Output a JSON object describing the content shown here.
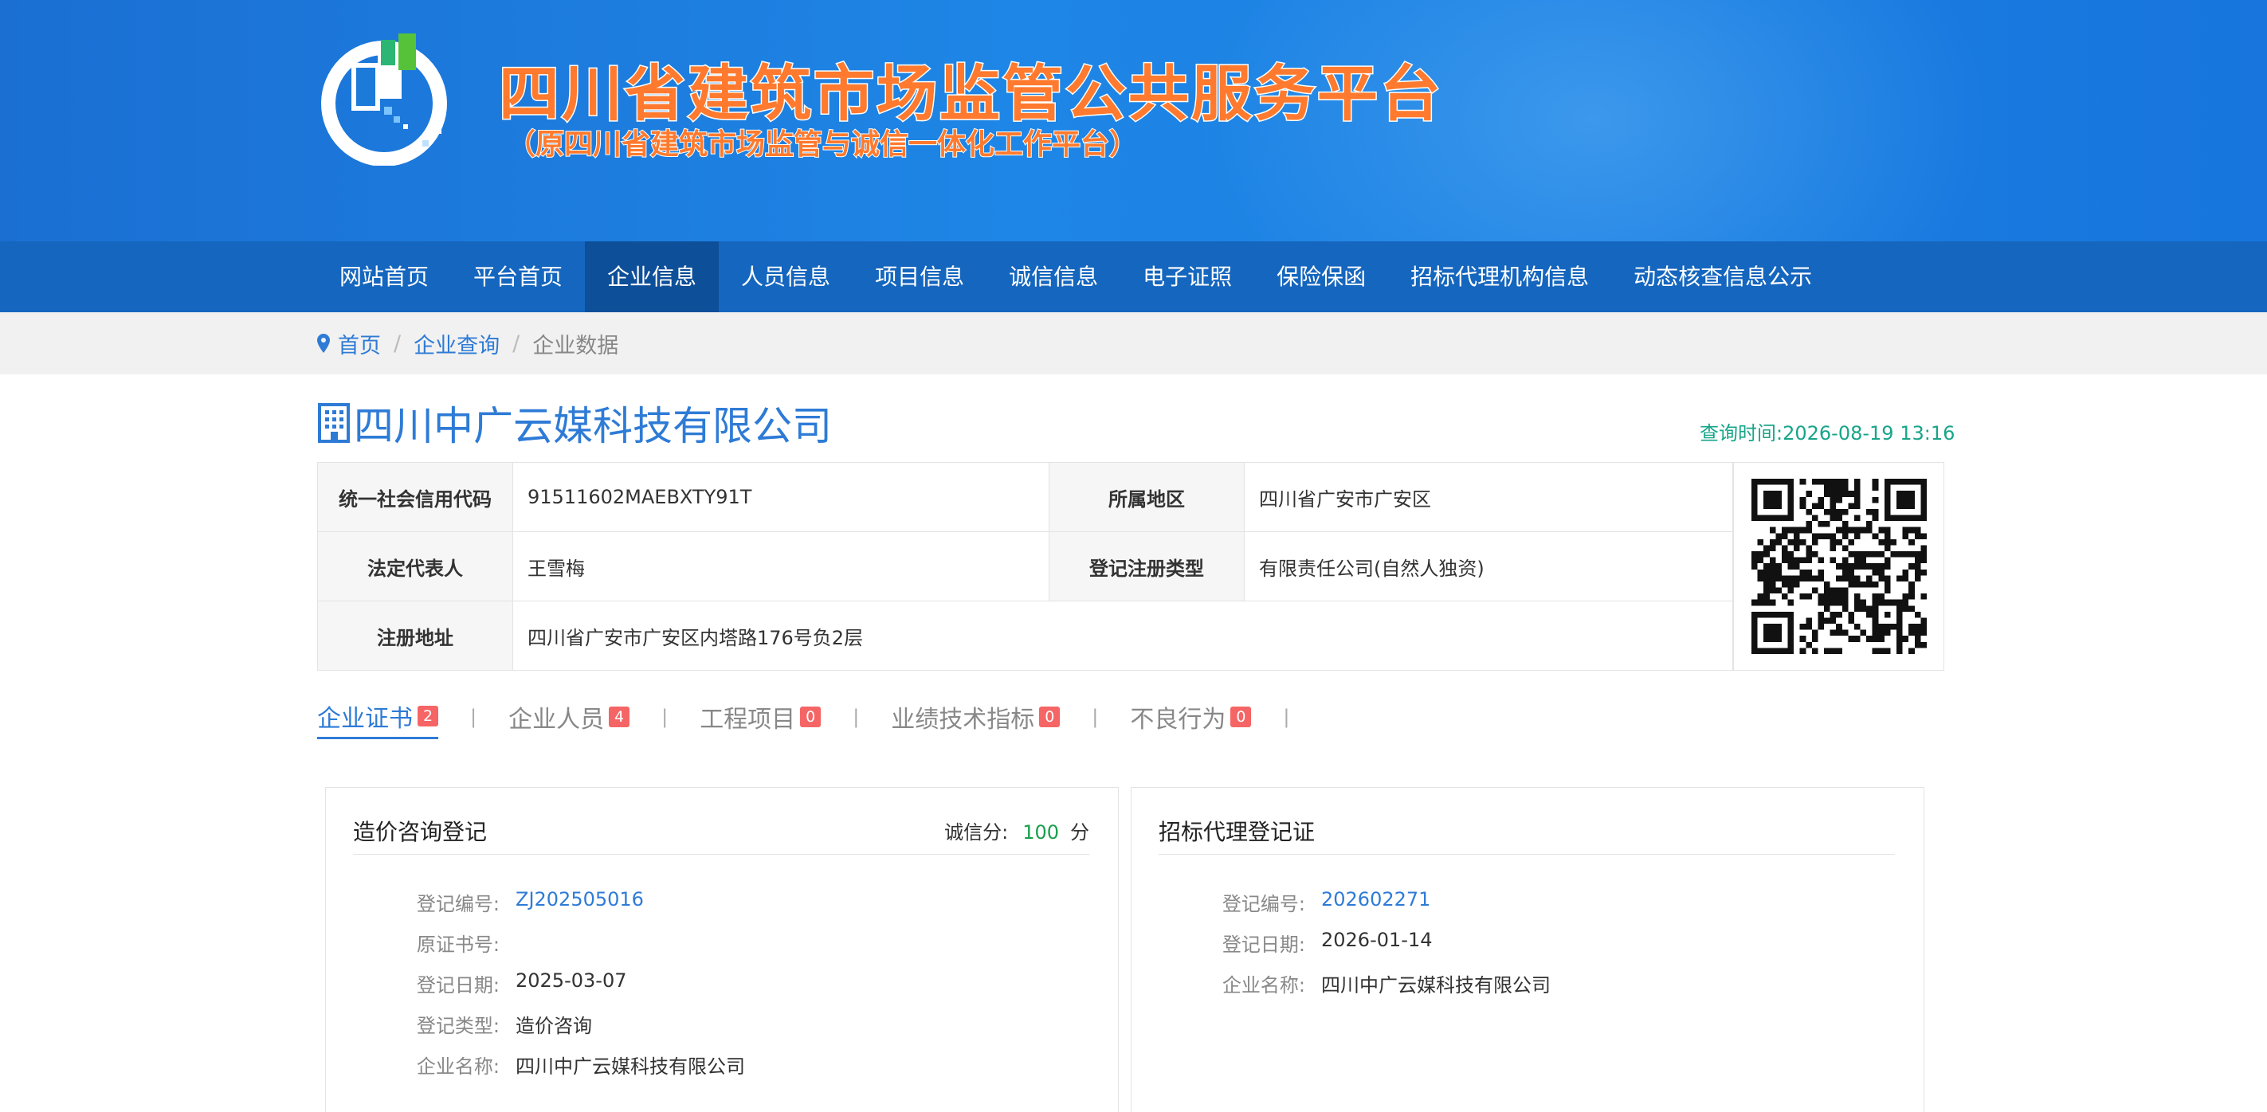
{
  "header": {
    "title": "四川省建筑市场监管公共服务平台",
    "subtitle": "（原四川省建筑市场监管与诚信一体化工作平台）"
  },
  "nav": {
    "items": [
      "网站首页",
      "平台首页",
      "企业信息",
      "人员信息",
      "项目信息",
      "诚信信息",
      "电子证照",
      "保险保函",
      "招标代理机构信息",
      "动态核查信息公示"
    ],
    "active": "企业信息"
  },
  "breadcrumb": {
    "home": "首页",
    "query": "企业查询",
    "current": "企业数据",
    "sep": "/"
  },
  "company": {
    "name": "四川中广云媒科技有限公司",
    "query_time": "查询时间:2026-08-19 13:16"
  },
  "info": {
    "credit_code_label": "统一社会信用代码",
    "credit_code": "91511602MAEBXTY91T",
    "region_label": "所属地区",
    "region": "四川省广安市广安区",
    "legal_rep_label": "法定代表人",
    "legal_rep": "王雪梅",
    "reg_type_label": "登记注册类型",
    "reg_type": "有限责任公司(自然人独资)",
    "address_label": "注册地址",
    "address": "四川省广安市广安区内塔路176号负2层"
  },
  "tabs": [
    {
      "label": "企业证书",
      "count": "2"
    },
    {
      "label": "企业人员",
      "count": "4"
    },
    {
      "label": "工程项目",
      "count": "0"
    },
    {
      "label": "业绩技术指标",
      "count": "0"
    },
    {
      "label": "不良行为",
      "count": "0"
    }
  ],
  "tab_sep": "|",
  "cards": {
    "left": {
      "title": "造价咨询登记",
      "score_label": "诚信分:",
      "score": "100",
      "score_unit": "分",
      "fields": [
        {
          "k": "登记编号:",
          "v": "ZJ202505016"
        },
        {
          "k": "原证书号:",
          "v": ""
        },
        {
          "k": "登记日期:",
          "v": "2025-03-07"
        },
        {
          "k": "登记类型:",
          "v": "造价咨询"
        },
        {
          "k": "企业名称:",
          "v": "四川中广云媒科技有限公司"
        }
      ]
    },
    "right": {
      "title": "招标代理登记证",
      "fields": [
        {
          "k": "登记编号:",
          "v": "202602271"
        },
        {
          "k": "登记日期:",
          "v": "2026-01-14"
        },
        {
          "k": "企业名称:",
          "v": "四川中广云媒科技有限公司"
        }
      ]
    }
  },
  "colors": {
    "brand_blue": "#1e86e6",
    "nav_bg": "#1566be",
    "link": "#2e7bd6",
    "accent_green": "#17a589",
    "badge_red": "#f56565"
  },
  "icons": [
    "platform-logo",
    "location-pin-icon",
    "building-icon",
    "qr-code"
  ]
}
